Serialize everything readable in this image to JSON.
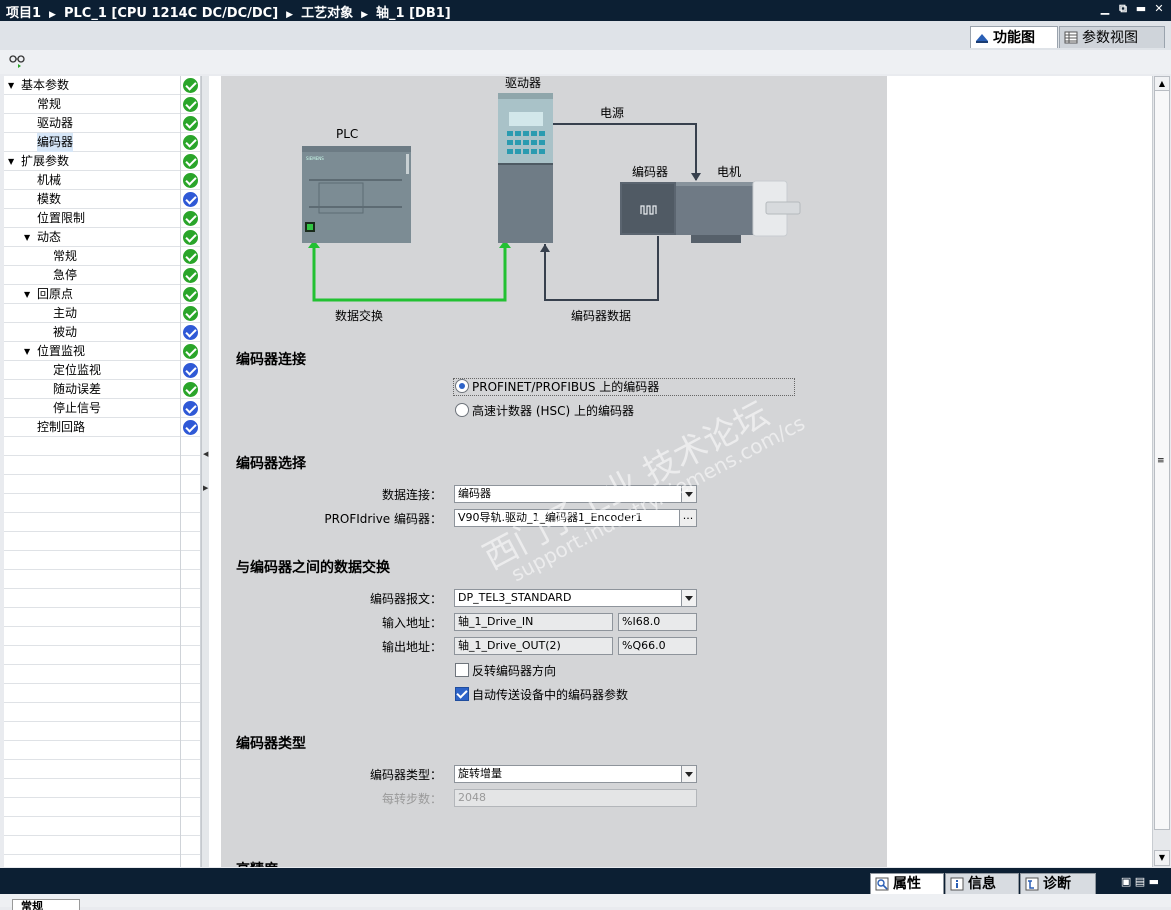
{
  "titlebar": {
    "crumbs": [
      "项目1",
      "PLC_1 [CPU 1214C DC/DC/DC]",
      "工艺对象",
      "轴_1 [DB1]"
    ],
    "sep": "▶",
    "controls": [
      "▁",
      "⧉",
      "▬",
      "✕"
    ]
  },
  "view_tabs": [
    {
      "label": "功能图",
      "active": true
    },
    {
      "label": "参数视图",
      "active": false
    }
  ],
  "tree": [
    {
      "label": "基本参数",
      "expanded": true,
      "status": "green"
    },
    {
      "label": "常规",
      "status": "green"
    },
    {
      "label": "驱动器",
      "status": "green"
    },
    {
      "label": "编码器",
      "status": "green",
      "selected": true
    },
    {
      "label": "扩展参数",
      "expanded": true,
      "status": "green"
    },
    {
      "label": "机械",
      "status": "green"
    },
    {
      "label": "模数",
      "status": "blue"
    },
    {
      "label": "位置限制",
      "status": "green"
    },
    {
      "label": "动态",
      "expanded": true,
      "status": "green"
    },
    {
      "label": "常规",
      "status": "green"
    },
    {
      "label": "急停",
      "status": "green"
    },
    {
      "label": "回原点",
      "expanded": true,
      "status": "green"
    },
    {
      "label": "主动",
      "status": "green"
    },
    {
      "label": "被动",
      "status": "blue"
    },
    {
      "label": "位置监视",
      "expanded": true,
      "status": "green"
    },
    {
      "label": "定位监视",
      "status": "blue"
    },
    {
      "label": "随动误差",
      "status": "green"
    },
    {
      "label": "停止信号",
      "status": "blue"
    },
    {
      "label": "控制回路",
      "status": "blue"
    }
  ],
  "diagram": {
    "drive_label": "驱动器",
    "plc_label": "PLC",
    "power_label": "电源",
    "encoder_label": "编码器",
    "motor_label": "电机",
    "data_exchange_label": "数据交换",
    "encoder_data_label": "编码器数据",
    "brand": "SIEMENS"
  },
  "encoder_connection": {
    "title": "编码器连接",
    "options": [
      {
        "label": "PROFINET/PROFIBUS 上的编码器",
        "selected": true
      },
      {
        "label": "高速计数器 (HSC) 上的编码器",
        "selected": false
      }
    ]
  },
  "encoder_selection": {
    "title": "编码器选择",
    "data_conn_label": "数据连接：",
    "data_conn_value": "编码器",
    "profidrive_label": "PROFIdrive 编码器：",
    "profidrive_value": "V90导轨.驱动_1_编码器1_Encoder1",
    "browse": "..."
  },
  "data_exchange": {
    "title": "与编码器之间的数据交换",
    "telegram_label": "编码器报文：",
    "telegram_value": "DP_TEL3_STANDARD",
    "input_label": "输入地址：",
    "input_name": "轴_1_Drive_IN",
    "input_addr": "%I68.0",
    "output_label": "输出地址：",
    "output_name": "轴_1_Drive_OUT(2)",
    "output_addr": "%Q66.0",
    "invert_label": "反转编码器方向",
    "invert_checked": false,
    "auto_label": "自动传送设备中的编码器参数",
    "auto_checked": true
  },
  "encoder_type": {
    "title": "编码器类型",
    "type_label": "编码器类型：",
    "type_value": "旋转增量",
    "steps_label": "每转步数：",
    "steps_value": "2048",
    "next_partial": "高精度"
  },
  "watermark": {
    "line1": "西门子工业 技术论坛",
    "line2": "support.industry.siemens.com/cs"
  },
  "bottom_tabs": [
    {
      "label": "属性",
      "active": true
    },
    {
      "label": "信息",
      "active": false
    },
    {
      "label": "诊断",
      "active": false
    }
  ],
  "bottom_strip_tab": "常规"
}
